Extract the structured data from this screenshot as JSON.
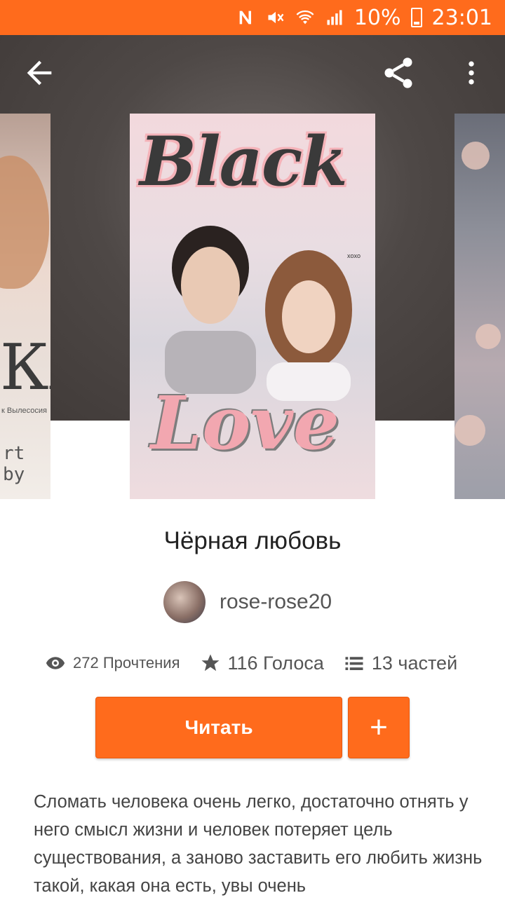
{
  "status_bar": {
    "battery": "10%",
    "time": "23:01",
    "icons": [
      "nfc-icon",
      "mute-icon",
      "wifi-icon",
      "signal-icon",
      "battery-icon"
    ]
  },
  "top_bar": {
    "icons": [
      "back-arrow-icon",
      "share-icon",
      "more-vert-icon"
    ]
  },
  "covers": {
    "main": {
      "title_top": "Black",
      "title_bottom": "Love",
      "small_text": "xoxo"
    },
    "left": {
      "text_big": "КА",
      "text_small": "к Вылесосия",
      "text_by": "rt by"
    }
  },
  "book": {
    "title": "Чёрная любовь",
    "author": "rose-rose20"
  },
  "stats": {
    "reads": "272 Прочтения",
    "votes": "116 Голоса",
    "parts": "13 частей"
  },
  "actions": {
    "read_label": "Читать",
    "add_label": "+"
  },
  "description": "Сломать человека очень легко, достаточно отнять у него смысл жизни и человек потеряет цель существования, а заново заставить его любить жизнь такой, какая она есть, увы очень",
  "colors": {
    "accent": "#ff6b1c",
    "text_primary": "#222222",
    "text_secondary": "#555555"
  }
}
